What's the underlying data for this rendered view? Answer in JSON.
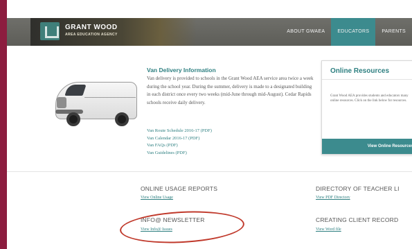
{
  "header": {
    "logo_name": "GRANT WOOD",
    "logo_sub": "AREA EDUCATION AGENCY",
    "nav": [
      {
        "label": "ABOUT GWAEA",
        "active": false
      },
      {
        "label": "EDUCATORS",
        "active": true
      },
      {
        "label": "PARENTS",
        "active": false
      }
    ]
  },
  "van_section": {
    "title": "Van Delivery Information",
    "description": "Van delivery is provided to schools in the Grant Wood AEA service area twice a week during the school year. During the summer, delivery is made to a designated building in each district once every two weeks (mid-June through mid-August). Cedar Rapids schools receive daily delivery.",
    "links": [
      "Van Route Schedule 2016-17 (PDF)",
      "Van Calendar 2016-17 (PDF)",
      "Van FAQs (PDF)",
      "Van Guidelines (PDF)"
    ]
  },
  "resources_card": {
    "title": "Online Resources",
    "text": "Grant Wood AEA provides students and educators many online resources. Click on the link below for resources.",
    "button": "View Online Resources"
  },
  "sections": [
    {
      "heading": "ONLINE USAGE REPORTS",
      "link": "View Online Usage"
    },
    {
      "heading": "DIRECTORY OF TEACHER LI",
      "link": "View PDF Directory"
    },
    {
      "heading": "INFO@ NEWSLETTER",
      "link": "View Info@ Issues"
    },
    {
      "heading": "CREATING CLIENT RECORD",
      "link": "View Word file"
    }
  ],
  "colors": {
    "brand_teal": "#3c8b8e",
    "frame_maroon": "#8c1d3f",
    "annotation_red": "#c0392b"
  }
}
